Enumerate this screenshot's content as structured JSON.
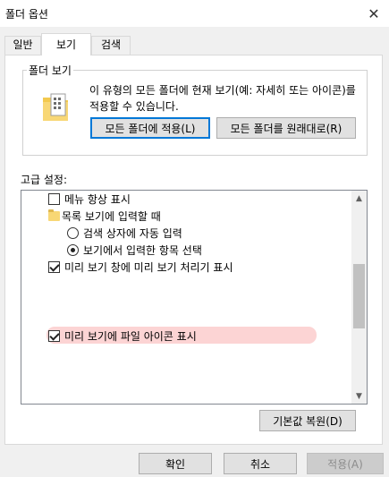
{
  "window": {
    "title": "폴더 옵션"
  },
  "tabs": [
    {
      "label": "일반",
      "active": false
    },
    {
      "label": "보기",
      "active": true
    },
    {
      "label": "검색",
      "active": false
    }
  ],
  "folder_views": {
    "legend": "폴더 보기",
    "description": "이 유형의 모든 폴더에 현재 보기(예: 자세히 또는 아이콘)를 적용할 수 있습니다.",
    "apply_button": "모든 폴더에 적용(L)",
    "reset_button": "모든 폴더를 원래대로(R)"
  },
  "advanced": {
    "label": "고급 설정:",
    "items": [
      {
        "type": "checkbox",
        "checked": false,
        "label": "메뉴 항상 표시"
      },
      {
        "type": "folder",
        "label": "목록 보기에 입력할 때"
      },
      {
        "type": "radio",
        "checked": false,
        "label": "검색 상자에 자동 입력"
      },
      {
        "type": "radio",
        "checked": true,
        "label": "보기에서 입력한 항목 선택"
      },
      {
        "type": "checkbox",
        "checked": true,
        "label": "미리 보기 창에 미리 보기 처리기 표시"
      },
      {
        "type": "checkbox",
        "checked": true,
        "label": "미리 보기에 파일 아이콘 표시"
      }
    ],
    "restore_defaults_button": "기본값 복원(D)"
  },
  "footer": {
    "ok_button": "확인",
    "cancel_button": "취소",
    "apply_button": "적용(A)"
  },
  "colors": {
    "highlight": "#fcd4d4",
    "default_button_border": "#0078d7"
  }
}
